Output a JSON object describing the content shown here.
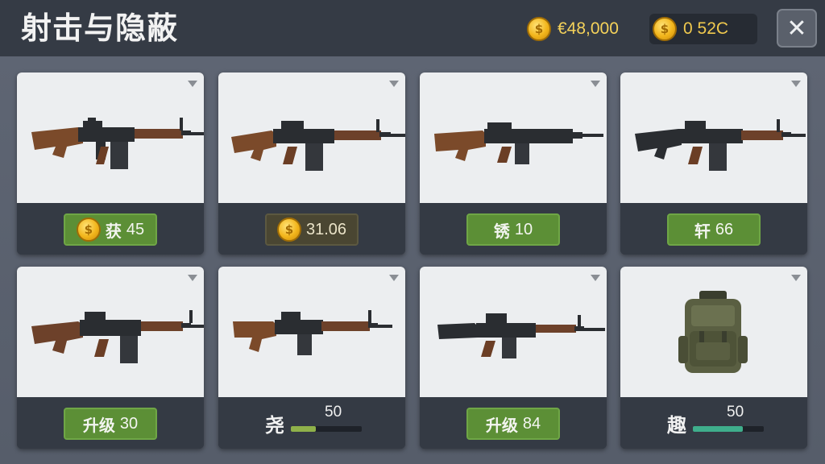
{
  "header": {
    "title": "射击与隐蔽",
    "coins_a": "€48,000",
    "coins_b": "0 52C",
    "close": "✕"
  },
  "colors": {
    "accent_green": "#5c8f36",
    "gold": "#f2b51b",
    "teal": "#3fae8c"
  },
  "cards": [
    {
      "kind": "button",
      "style": "green",
      "coin": true,
      "label": "获",
      "value": "45"
    },
    {
      "kind": "button",
      "style": "dark",
      "coin": true,
      "label": "",
      "value": "31.06"
    },
    {
      "kind": "button",
      "style": "green",
      "coin": false,
      "label": "锈",
      "value": "10"
    },
    {
      "kind": "button",
      "style": "green",
      "coin": false,
      "label": "轩",
      "value": "66"
    },
    {
      "kind": "button",
      "style": "green",
      "coin": false,
      "label": "升级",
      "value": "30"
    },
    {
      "kind": "progress",
      "label": "尧",
      "value": "50",
      "fill": 0.35,
      "fill_color": "#8fb14a"
    },
    {
      "kind": "button",
      "style": "green",
      "coin": false,
      "label": "升级",
      "value": "84"
    },
    {
      "kind": "progress",
      "label": "趣",
      "value": "50",
      "fill": 0.7,
      "fill_color": "#3fae8c"
    }
  ],
  "icons": [
    "rifle-icon",
    "rifle-icon",
    "rifle-icon",
    "rifle-icon",
    "rifle-icon",
    "rifle-icon",
    "rifle-icon",
    "backpack-icon"
  ],
  "coin_symbol": "$"
}
